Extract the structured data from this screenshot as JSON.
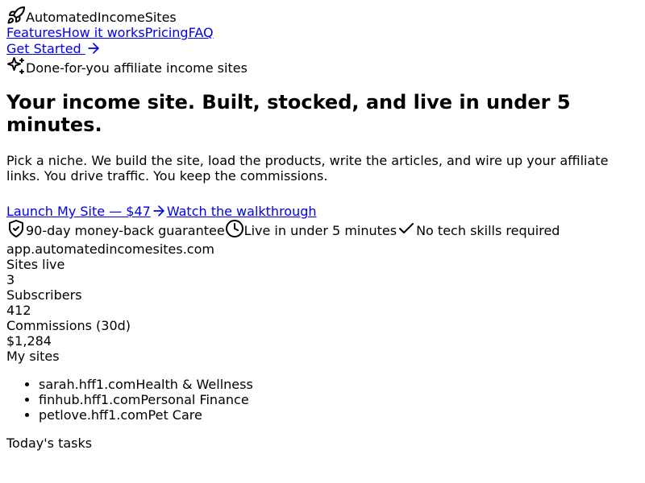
{
  "brand": {
    "name": "AutomatedIncomeSites",
    "icon": "rocket-icon"
  },
  "nav": {
    "items": [
      "Features",
      "How it works",
      "Pricing",
      "FAQ"
    ]
  },
  "header": {
    "cta_label": "Get Started",
    "cta_icon": "arrow-right-icon"
  },
  "hero": {
    "tagline": "Done-for-you affiliate income sites",
    "tagline_icon": "sparkles-icon",
    "title": "Your income site. Built, stocked, and live in under 5 minutes.",
    "lead": "Pick a niche. We build the site, load the products, write the articles, and wire up your affiliate links. You drive traffic. You keep the commissions.",
    "primary_cta": "Launch My Site — $47",
    "secondary_cta": "Watch the walkthrough"
  },
  "trust": {
    "items": [
      {
        "label": "90-day money-back guarantee",
        "icon": "shield-check-icon"
      },
      {
        "label": "Live in under 5 minutes",
        "icon": "clock-icon"
      },
      {
        "label": "No tech skills required",
        "icon": "check-icon"
      }
    ]
  },
  "preview": {
    "url": "app.automatedincomesites.com",
    "stats": [
      {
        "label": "Sites live",
        "value": "3"
      },
      {
        "label": "Subscribers",
        "value": "412"
      },
      {
        "label": "Commissions (30d)",
        "value": "$1,284"
      }
    ],
    "sites_title": "My sites",
    "sites": [
      {
        "domain": "sarah.hff1.com",
        "niche": "Health & Wellness"
      },
      {
        "domain": "finhub.hff1.com",
        "niche": "Personal Finance"
      },
      {
        "domain": "petlove.hff1.com",
        "niche": "Pet Care"
      }
    ],
    "tasks_title": "Today's tasks"
  }
}
